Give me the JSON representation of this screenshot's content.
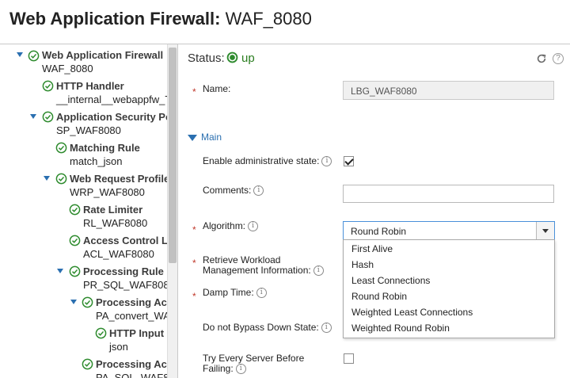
{
  "page": {
    "title_bold": "Web Application Firewall:",
    "title_rest": " WAF_8080"
  },
  "tree": {
    "nodes": [
      {
        "label": "Web Application Firewall",
        "sub": "WAF_8080",
        "expanded": true
      },
      {
        "label": "HTTP Handler",
        "sub": "__internal__webappfw_T",
        "expanded": false
      },
      {
        "label": "Application Security Po",
        "sub": "SP_WAF8080",
        "expanded": true
      },
      {
        "label": "Matching Rule",
        "sub": "match_json",
        "expanded": false
      },
      {
        "label": "Web Request Profile",
        "sub": "WRP_WAF8080",
        "expanded": true
      },
      {
        "label": "Rate Limiter",
        "sub": "RL_WAF8080",
        "expanded": false
      },
      {
        "label": "Access Control L",
        "sub": "ACL_WAF8080",
        "expanded": false
      },
      {
        "label": "Processing Rule",
        "sub": "PR_SQL_WAF808(",
        "expanded": true
      },
      {
        "label": "Processing Ac",
        "sub": "PA_convert_WA",
        "expanded": true
      },
      {
        "label": "HTTP Input",
        "sub": "json",
        "expanded": false
      },
      {
        "label": "Processing Ac",
        "sub": "PA_SQL_WAF8",
        "expanded": false
      }
    ]
  },
  "status": {
    "label": "Status:",
    "value": "up",
    "color": "#2a7d1f"
  },
  "form": {
    "name_label": "Name:",
    "name_value": "LBG_WAF8080",
    "section_main": "Main",
    "enable_admin_label": "Enable administrative state:",
    "enable_admin_checked": true,
    "comments_label": "Comments:",
    "comments_value": "",
    "algorithm_label": "Algorithm:",
    "algorithm_value": "Round Robin",
    "algorithm_options": [
      "First Alive",
      "Hash",
      "Least Connections",
      "Round Robin",
      "Weighted Least Connections",
      "Weighted Round Robin"
    ],
    "retrieve_workload_label_1": "Retrieve Workload",
    "retrieve_workload_label_2": "Management Information:",
    "damp_time_label": "Damp Time:",
    "bypass_label": "Do not Bypass Down State:",
    "try_every_label_1": "Try Every Server Before",
    "try_every_label_2": "Failing:",
    "try_every_checked": false
  },
  "icons": {
    "tree_status": "check-circle-icon",
    "refresh": "refresh-icon",
    "help": "help-icon",
    "info": "info-icon",
    "expand": "chevron-down-icon",
    "accent": "#2a6fb0",
    "required": "#c0392b"
  }
}
